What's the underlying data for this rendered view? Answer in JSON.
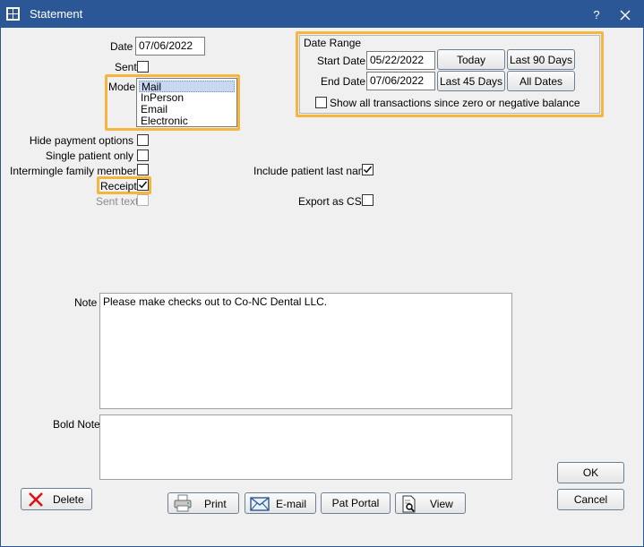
{
  "window": {
    "title": "Statement",
    "help_label": "?"
  },
  "form": {
    "date_label": "Date",
    "date_value": "07/06/2022",
    "sent_label": "Sent",
    "mode_label": "Mode",
    "mode_options": [
      "Mail",
      "InPerson",
      "Email",
      "Electronic"
    ],
    "mode_selected": "Mail",
    "hide_payment_label": "Hide payment options",
    "single_patient_label": "Single patient only",
    "intermingle_label": "Intermingle family members",
    "receipt_label": "Receipt",
    "sent_text_label": "Sent text",
    "include_last_name_label": "Include patient last name",
    "export_csv_label": "Export as CSV"
  },
  "date_range": {
    "title": "Date Range",
    "start_label": "Start Date",
    "start_value": "05/22/2022",
    "end_label": "End Date",
    "end_value": "07/06/2022",
    "today_label": "Today",
    "last90_label": "Last 90 Days",
    "last45_label": "Last 45 Days",
    "all_dates_label": "All Dates",
    "show_all_label": "Show all transactions since zero or negative balance"
  },
  "notes": {
    "note_label": "Note",
    "note_value": "Please make checks out to Co-NC Dental LLC.",
    "bold_note_label": "Bold Note",
    "bold_note_value": ""
  },
  "buttons": {
    "delete_label": "Delete",
    "print_label": "Print",
    "email_label": "E-mail",
    "pat_portal_label": "Pat Portal",
    "view_label": "View",
    "ok_label": "OK",
    "cancel_label": "Cancel"
  },
  "checkbox_state": {
    "sent": false,
    "hide_payment": false,
    "single_patient": false,
    "intermingle": false,
    "receipt": true,
    "sent_text": false,
    "include_last_name": true,
    "export_csv": false,
    "show_all": false
  },
  "colors": {
    "titlebar": "#2b5797",
    "highlight": "#f5b640",
    "selection": "#c7d8f0"
  }
}
